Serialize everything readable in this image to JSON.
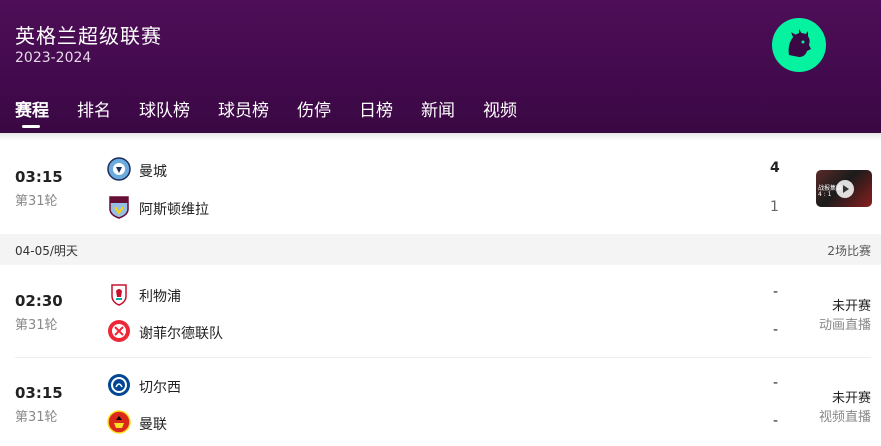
{
  "header": {
    "title": "英格兰超级联赛",
    "season": "2023-2024",
    "logo_icon": "premier-league-lion-icon",
    "accent": "#05f3a0",
    "background": "#4e0e58"
  },
  "tabs": [
    {
      "label": "赛程",
      "active": true
    },
    {
      "label": "排名"
    },
    {
      "label": "球队榜"
    },
    {
      "label": "球员榜"
    },
    {
      "label": "伤停"
    },
    {
      "label": "日榜"
    },
    {
      "label": "新闻"
    },
    {
      "label": "视频"
    }
  ],
  "matches": [
    {
      "time": "03:15",
      "round": "第31轮",
      "home": {
        "name": "曼城",
        "score": "4",
        "icon": "man-city-crest-icon"
      },
      "away": {
        "name": "阿斯顿维拉",
        "score": "1",
        "icon": "aston-villa-crest-icon"
      },
      "video_thumb": {
        "caption": "战报集锦",
        "score_text": "4 : 1"
      }
    },
    {
      "time": "02:30",
      "round": "第31轮",
      "home": {
        "name": "利物浦",
        "score": "-",
        "icon": "liverpool-crest-icon"
      },
      "away": {
        "name": "谢菲尔德联队",
        "score": "-",
        "icon": "sheffield-united-crest-icon"
      },
      "status": "未开赛",
      "broadcast": "动画直播"
    },
    {
      "time": "03:15",
      "round": "第31轮",
      "home": {
        "name": "切尔西",
        "score": "-",
        "icon": "chelsea-crest-icon"
      },
      "away": {
        "name": "曼联",
        "score": "-",
        "icon": "man-united-crest-icon"
      },
      "status": "未开赛",
      "broadcast": "视频直播"
    }
  ],
  "date_bar": {
    "date": "04-05/明天",
    "count": "2场比赛"
  }
}
